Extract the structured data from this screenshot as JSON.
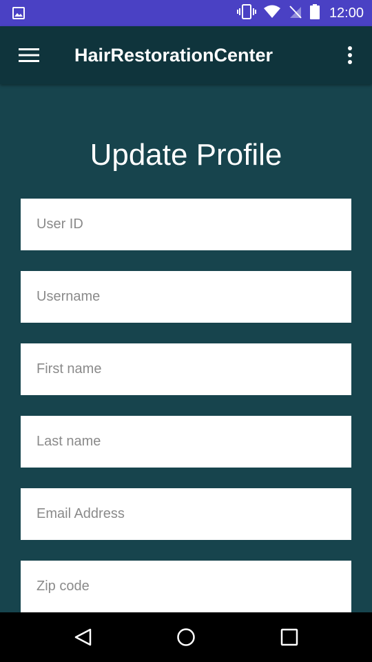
{
  "status_bar": {
    "time": "12:00",
    "icons": [
      "image-icon",
      "vibrate-icon",
      "wifi-icon",
      "no-sim-icon",
      "battery-icon"
    ]
  },
  "app_bar": {
    "title": "HairRestorationCenter",
    "menu_icon": "hamburger-menu-icon",
    "overflow_icon": "more-vert-icon"
  },
  "page": {
    "title": "Update Profile"
  },
  "form": {
    "fields": [
      {
        "placeholder": "User ID",
        "value": ""
      },
      {
        "placeholder": "Username",
        "value": ""
      },
      {
        "placeholder": "First name",
        "value": ""
      },
      {
        "placeholder": "Last name",
        "value": ""
      },
      {
        "placeholder": "Email Address",
        "value": ""
      },
      {
        "placeholder": "Zip code",
        "value": ""
      }
    ]
  },
  "nav_bar": {
    "icons": [
      "back-icon",
      "home-icon",
      "recents-icon"
    ]
  },
  "colors": {
    "status_bar": "#4a41c4",
    "app_bar": "#0f343c",
    "background": "#17444d",
    "field": "#ffffff",
    "placeholder": "#8a8a8a"
  }
}
